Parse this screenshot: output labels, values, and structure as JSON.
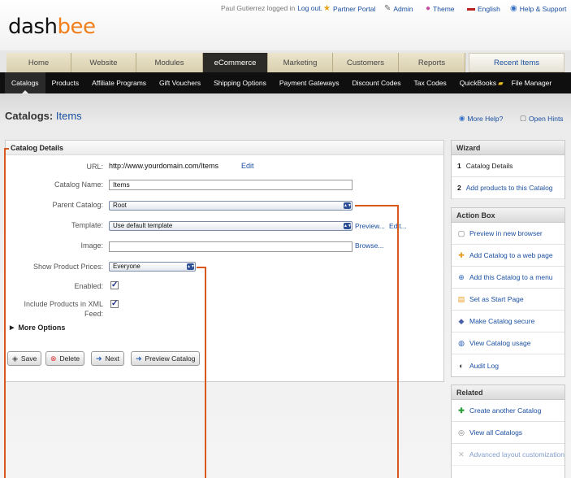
{
  "logo": {
    "part1": "dash",
    "part2": "bee"
  },
  "topbar": {
    "user_text": "Paul Gutierrez logged in",
    "logout": "Log out.",
    "partner_portal": "Partner Portal",
    "admin": "Admin",
    "theme": "Theme",
    "english": "English",
    "help": "Help & Support"
  },
  "tabs": [
    "Home",
    "Website",
    "Modules",
    "eCommerce",
    "Marketing",
    "Customers",
    "Reports"
  ],
  "recent_items": "Recent Items",
  "subnav": [
    "Catalogs",
    "Products",
    "Affiliate Programs",
    "Gift Vouchers",
    "Shipping Options",
    "Payment Gateways",
    "Discount Codes",
    "Tax Codes",
    "QuickBooks",
    "File Manager"
  ],
  "page": {
    "title_prefix": "Catalogs:",
    "title_item": "Items",
    "more_help": "More Help?",
    "open_hints": "Open Hints"
  },
  "form": {
    "section_title": "Catalog Details",
    "url_label": "URL:",
    "url_value": "http://www.yourdomain.com/Items",
    "url_edit": "Edit",
    "name_label": "Catalog Name:",
    "name_value": "Items",
    "parent_label": "Parent Catalog:",
    "parent_value": "Root",
    "template_label": "Template:",
    "template_value": "Use default template",
    "template_preview": "Preview...",
    "template_edit": "Edit...",
    "image_label": "Image:",
    "image_value": "",
    "image_browse": "Browse...",
    "prices_label": "Show Product Prices:",
    "prices_value": "Everyone",
    "enabled_label": "Enabled:",
    "enabled": true,
    "xml_label_1": "Include Products in XML",
    "xml_label_2": "Feed:",
    "xml_enabled": true,
    "more_options": "More Options"
  },
  "buttons": {
    "save": "Save",
    "delete": "Delete",
    "next": "Next",
    "preview": "Preview Catalog"
  },
  "wizard": {
    "title": "Wizard",
    "step1_num": "1",
    "step1": "Catalog Details",
    "step2_num": "2",
    "step2": "Add products to this Catalog"
  },
  "action_box": {
    "title": "Action Box",
    "items": [
      "Preview in new browser",
      "Add Catalog to a web page",
      "Add this Catalog to a menu",
      "Set as Start Page",
      "Make Catalog secure",
      "View Catalog usage",
      "Audit Log"
    ]
  },
  "related": {
    "title": "Related",
    "items": [
      "Create another Catalog",
      "View all Catalogs",
      "Advanced layout customization"
    ]
  }
}
